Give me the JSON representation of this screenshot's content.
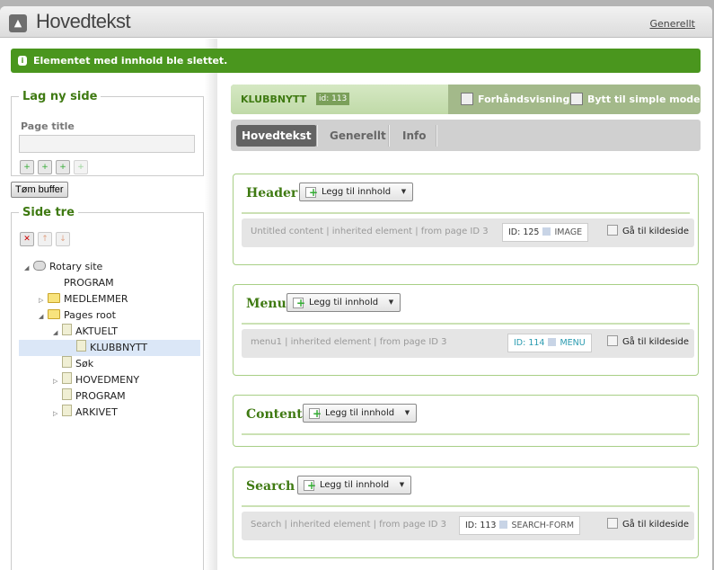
{
  "window": {
    "title": "Hovedtekst",
    "top_link": "Generellt",
    "up_icon": "arrow-up-icon"
  },
  "notice": {
    "text": "Elementet med innhold ble slettet.",
    "icon": "info-icon",
    "color": "#4a961e"
  },
  "new_page": {
    "legend": "Lag ny side",
    "label": "Page title",
    "value": "",
    "buttons": [
      "add-before-icon",
      "add-after-icon",
      "add-child-icon",
      "add-disabled-icon"
    ]
  },
  "buffer_button": "Tøm buffer",
  "tree": {
    "legend": "Side tre",
    "tools": [
      "delete-icon",
      "move-up-icon",
      "move-down-icon"
    ],
    "items": [
      {
        "label": "Rotary site",
        "icon": "site",
        "toggle": "open"
      },
      {
        "label": "PROGRAM",
        "icon": "program",
        "toggle": ""
      },
      {
        "label": "MEDLEMMER",
        "icon": "folder",
        "toggle": "closed"
      },
      {
        "label": "Pages root",
        "icon": "folder",
        "toggle": "open"
      },
      {
        "label": "AKTUELT",
        "icon": "page",
        "toggle": "open"
      },
      {
        "label": "KLUBBNYTT",
        "icon": "page",
        "toggle": "",
        "selected": true
      },
      {
        "label": "Søk",
        "icon": "page",
        "toggle": ""
      },
      {
        "label": "HOVEDMENY",
        "icon": "page",
        "toggle": "closed"
      },
      {
        "label": "PROGRAM",
        "icon": "page",
        "toggle": ""
      },
      {
        "label": "ARKIVET",
        "icon": "page",
        "toggle": "closed"
      }
    ]
  },
  "page": {
    "name": "KLUBBNYTT",
    "id": "id: 113",
    "preview": "Forhåndsvisning",
    "simple_mode": "Bytt til simple mode"
  },
  "tabs": [
    {
      "label": "Hovedtekst",
      "active": true
    },
    {
      "label": "Generellt"
    },
    {
      "label": "Info"
    }
  ],
  "add_label": "Legg til innhold",
  "goto_label": "Gå til kildeside",
  "sections": [
    {
      "title": "Header",
      "item": {
        "text": "Untitled content | inherited element | from page ID 3",
        "id": "ID: 125",
        "type": "IMAGE"
      }
    },
    {
      "title": "Menu",
      "item": {
        "text": "menu1 | inherited element | from page ID 3",
        "id": "ID: 114",
        "type": "MENU"
      }
    },
    {
      "title": "Content"
    },
    {
      "title": "Search",
      "item": {
        "text": "Search | inherited element | from page ID 3",
        "id": "ID: 113",
        "type": "SEARCH-FORM"
      }
    }
  ]
}
